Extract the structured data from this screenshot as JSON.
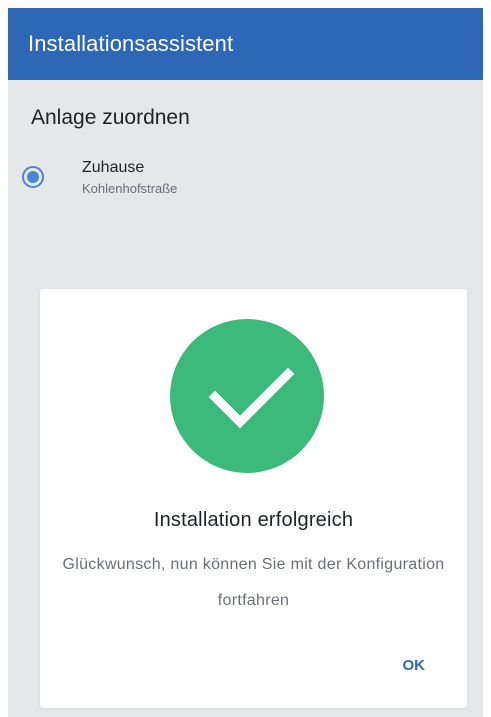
{
  "app_bar": {
    "title": "Installationsassistent"
  },
  "section": {
    "title": "Anlage zuordnen"
  },
  "plant": {
    "name": "Zuhause",
    "address": "Kohlenhofstraße",
    "selected": true
  },
  "dialog": {
    "icon": "checkmark-icon",
    "title": "Installation erfolgreich",
    "message": "Glückwunsch, nun können Sie mit der Konfiguration fortfahren",
    "ok_label": "OK"
  },
  "colors": {
    "app_bar": "#2d67b5",
    "background": "#e6e7e9",
    "accent": "#4b86d6",
    "success": "#3bba7b",
    "action": "#2d67b5"
  }
}
